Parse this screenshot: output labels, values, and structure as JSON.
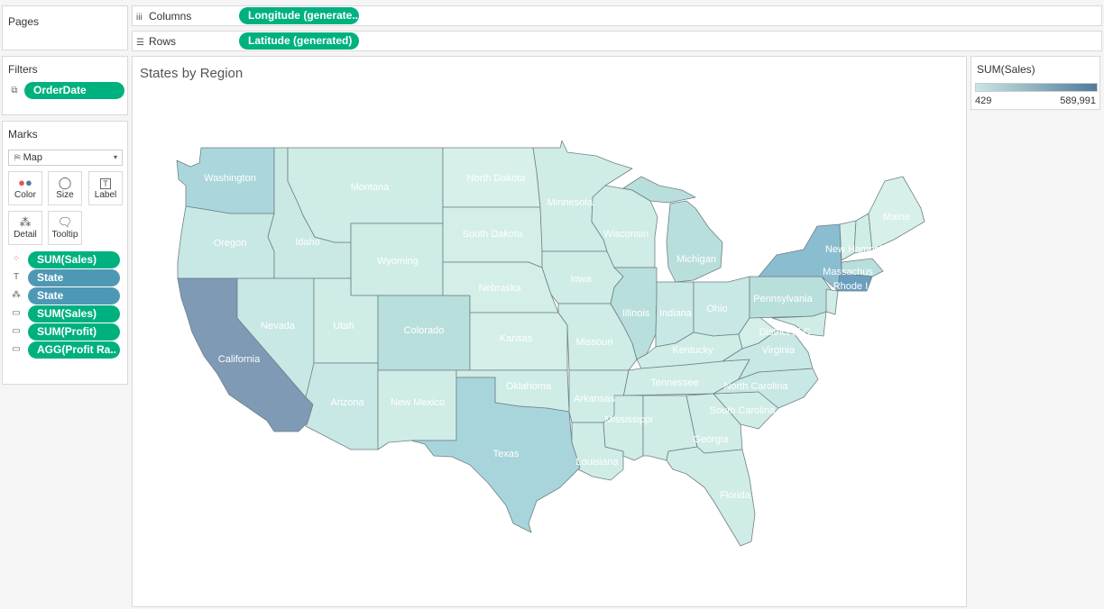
{
  "pages": {
    "title": "Pages"
  },
  "columns": {
    "label": "Columns",
    "pill": "Longitude (generate.."
  },
  "rows": {
    "label": "Rows",
    "pill": "Latitude (generated)"
  },
  "filters": {
    "title": "Filters",
    "pill": "OrderDate"
  },
  "marks": {
    "title": "Marks",
    "type": "Map",
    "buttons": [
      {
        "label": "Color",
        "icon": "color-dots-icon"
      },
      {
        "label": "Size",
        "icon": "size-icon"
      },
      {
        "label": "Label",
        "icon": "label-icon"
      },
      {
        "label": "Detail",
        "icon": "detail-icon"
      },
      {
        "label": "Tooltip",
        "icon": "tooltip-icon"
      }
    ],
    "fields": [
      {
        "label": "SUM(Sales)",
        "icon": "color-dots-icon",
        "color": "green"
      },
      {
        "label": "State",
        "icon": "label-icon",
        "color": "blue"
      },
      {
        "label": "State",
        "icon": "detail-icon",
        "color": "blue"
      },
      {
        "label": "SUM(Sales)",
        "icon": "tooltip-icon",
        "color": "green"
      },
      {
        "label": "SUM(Profit)",
        "icon": "tooltip-icon",
        "color": "green"
      },
      {
        "label": "AGG(Profit Ra..",
        "icon": "tooltip-icon",
        "color": "green"
      }
    ]
  },
  "view": {
    "title": "States by Region"
  },
  "legend": {
    "title": "SUM(Sales)",
    "min": "429",
    "max": "589,991",
    "color_low": "#c9e6e3",
    "color_high": "#4f7a9e"
  },
  "states": {
    "washington": "Washington",
    "oregon": "Oregon",
    "california": "California",
    "montana": "Montana",
    "idaho": "Idaho",
    "wyoming": "Wyoming",
    "nevada": "Nevada",
    "utah": "Utah",
    "colorado": "Colorado",
    "arizona": "Arizona",
    "new_mexico": "New Mexico",
    "north_dakota": "North Dakota",
    "south_dakota": "South Dakota",
    "nebraska": "Nebraska",
    "kansas": "Kansas",
    "oklahoma": "Oklahoma",
    "texas": "Texas",
    "minnesota": "Minnesota",
    "iowa": "Iowa",
    "missouri": "Missouri",
    "arkansas": "Arkansas",
    "louisiana": "Louisiana",
    "wisconsin": "Wisconsin",
    "illinois": "Illinois",
    "michigan": "Michigan",
    "indiana": "Indiana",
    "ohio": "Ohio",
    "kentucky": "Kentucky",
    "tennessee": "Tennessee",
    "mississippi": "Mississippi",
    "alabama": "",
    "georgia": "Georgia",
    "florida": "Florida",
    "south_carolina": "South Carolina",
    "north_carolina": "North Carolina",
    "virginia": "Virginia",
    "west_virginia": "",
    "pennsylvania": "Pennsylvania",
    "new_york": "",
    "maine": "Maine",
    "new_hampshire": "New Hampsh",
    "massachusetts": "Massachus",
    "rhode_island": "Rhode I",
    "district_of_columbia": "District of C"
  }
}
